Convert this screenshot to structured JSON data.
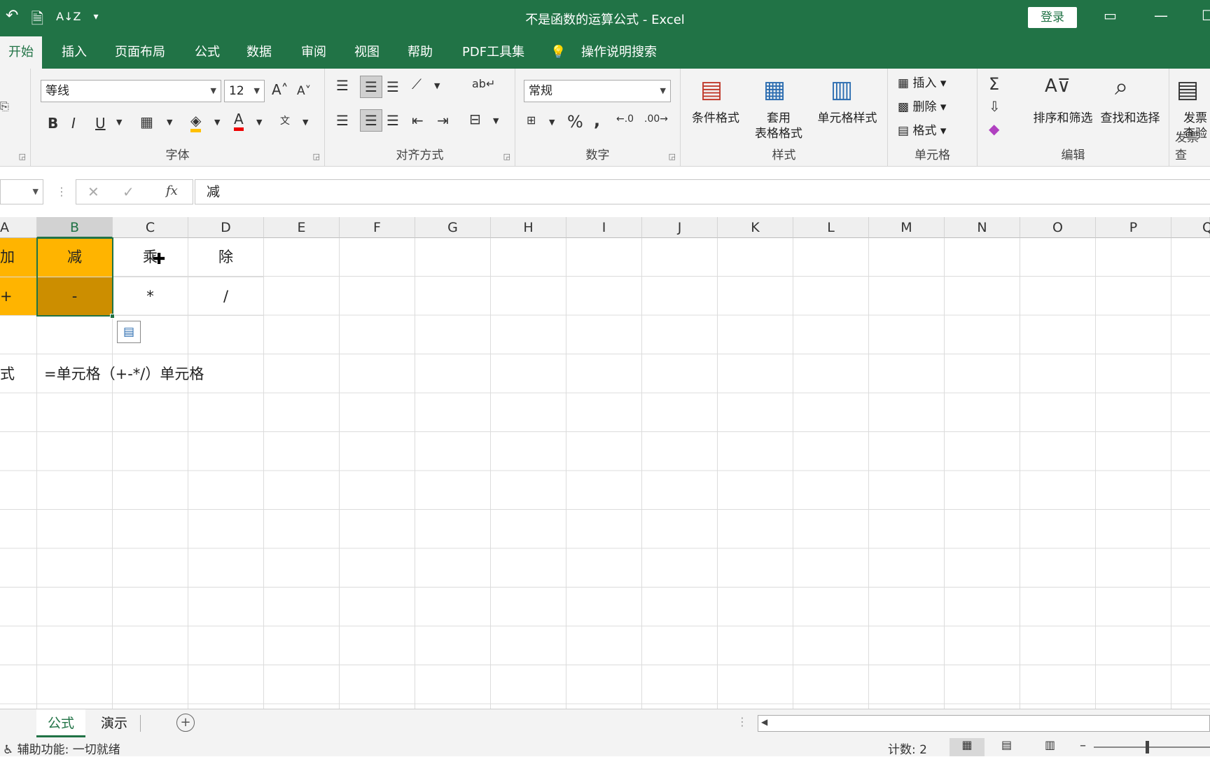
{
  "titlebar": {
    "title": "不是函数的运算公式  -  Excel",
    "login": "登录",
    "qat_undo": "↶",
    "qat_sort": "A↓Z",
    "qat_more": "▾"
  },
  "tabs": [
    "开始",
    "插入",
    "页面布局",
    "公式",
    "数据",
    "审阅",
    "视图",
    "帮助",
    "PDF工具集",
    "操作说明搜索"
  ],
  "ribbon": {
    "font_name": "等线",
    "font_size": "12",
    "font_group": "字体",
    "align_group": "对齐方式",
    "number_format": "常规",
    "number_group": "数字",
    "cond_format": "条件格式",
    "table_format_1": "套用",
    "table_format_2": "表格格式",
    "cell_style": "单元格样式",
    "style_group": "样式",
    "insert": "插入",
    "delete": "删除",
    "format": "格式",
    "cells_group": "单元格",
    "sort_filter": "排序和筛选",
    "find_select": "查找和选择",
    "edit_group": "编辑",
    "invoice_1": "发票",
    "invoice_2": "查验",
    "invoice_group": "发票查"
  },
  "formula_bar": {
    "value": "减",
    "fx": "fx"
  },
  "columns": [
    "A",
    "B",
    "C",
    "D",
    "E",
    "F",
    "G",
    "H",
    "I",
    "J",
    "K",
    "L",
    "M",
    "N",
    "O",
    "P",
    "Q"
  ],
  "cells": {
    "a1": "加",
    "b1": "减",
    "c1": "乘",
    "d1": "除",
    "a2": "+",
    "b2": "-",
    "c2": "*",
    "d2": "/",
    "a4": "式",
    "b4": "=单元格（+-*/）单元格"
  },
  "sheets": [
    "公式",
    "演示"
  ],
  "status": {
    "ready": "辅助功能: 一切就绪",
    "count": "计数: 2"
  },
  "colors": {
    "excel_green": "#217346",
    "header_orange": "#FFB400",
    "selected_dark": "#CC8E00"
  }
}
